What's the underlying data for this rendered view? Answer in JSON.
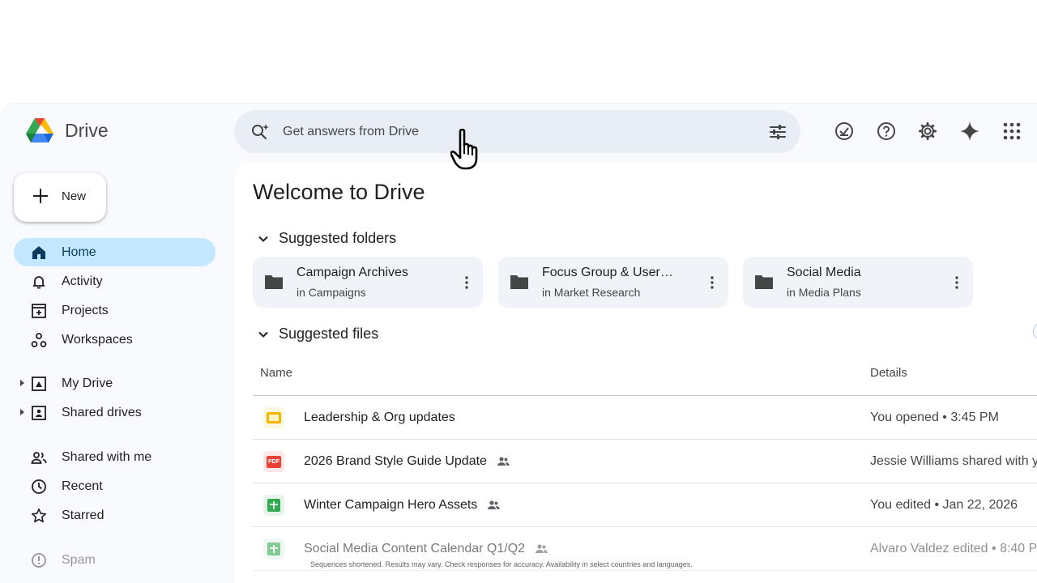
{
  "app": {
    "title": "Drive",
    "search": {
      "placeholder": "Get answers from Drive"
    },
    "top_icons": [
      "ready-for-offline-icon",
      "help-icon",
      "settings-icon",
      "gemini-icon",
      "apps-grid-icon"
    ]
  },
  "sidebar": {
    "new_label": "New",
    "items": [
      {
        "label": "Home",
        "icon": "home-icon",
        "active": true
      },
      {
        "label": "Activity",
        "icon": "bell-icon"
      },
      {
        "label": "Projects",
        "icon": "projects-icon"
      },
      {
        "label": "Workspaces",
        "icon": "workspaces-icon"
      },
      {
        "label": "My Drive",
        "icon": "my-drive-icon",
        "expandable": true
      },
      {
        "label": "Shared drives",
        "icon": "shared-drives-icon",
        "expandable": true
      },
      {
        "label": "Shared with me",
        "icon": "people-icon"
      },
      {
        "label": "Recent",
        "icon": "clock-icon"
      },
      {
        "label": "Starred",
        "icon": "star-icon"
      },
      {
        "label": "Spam",
        "icon": "spam-icon"
      }
    ]
  },
  "main": {
    "welcome": "Welcome to Drive",
    "suggested_folders_title": "Suggested folders",
    "folders": [
      {
        "name": "Campaign Archives",
        "location": "in Campaigns"
      },
      {
        "name": "Focus Group & User…",
        "location": "in Market Research"
      },
      {
        "name": "Social Media",
        "location": "in Media Plans"
      }
    ],
    "suggested_files_title": "Suggested files",
    "columns": {
      "name": "Name",
      "details": "Details"
    },
    "files": [
      {
        "name": "Leadership & Org updates",
        "type": "slides",
        "shared": false,
        "detail": "You opened • 3:45 PM"
      },
      {
        "name": "2026 Brand Style Guide Update",
        "type": "pdf",
        "type_label": "PDF",
        "shared": true,
        "detail": "Jessie Williams shared with y"
      },
      {
        "name": "Winter Campaign Hero Assets",
        "type": "sheets",
        "shared": true,
        "detail": "You edited • Jan 22, 2026"
      },
      {
        "name": "Social Media Content Calendar Q1/Q2",
        "type": "sheets",
        "shared": true,
        "detail": "Alvaro Valdez edited • 8:40 P"
      }
    ]
  },
  "disclaimer": "Sequences shortened. Results may vary. Check responses for accuracy. Availability in select countries and languages.",
  "colors": {
    "accent": "#c2e7ff",
    "search_bg": "#e9eef6",
    "slides": "#f4b400",
    "pdf": "#ea4335",
    "sheets": "#34a853"
  }
}
